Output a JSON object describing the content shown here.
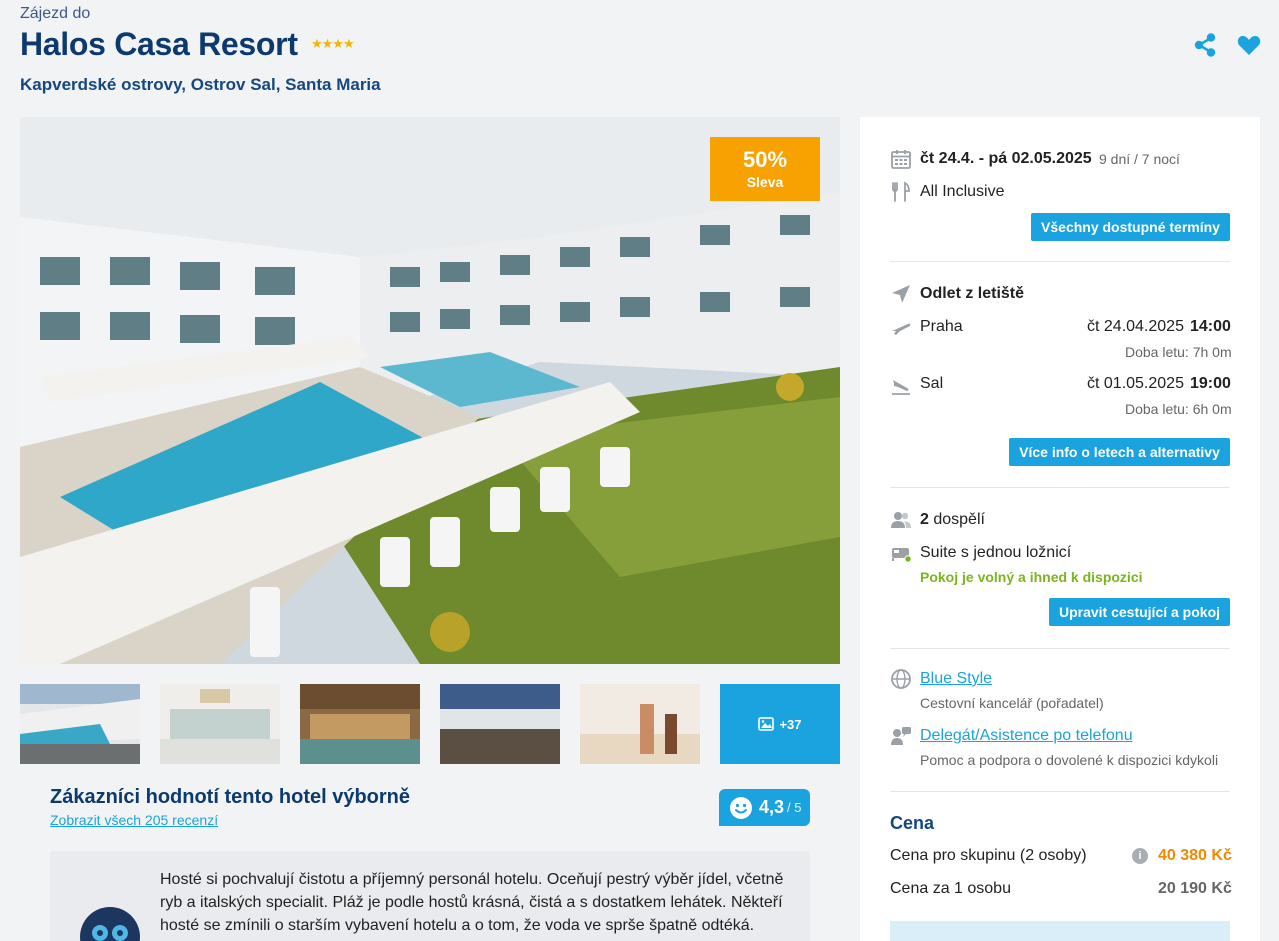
{
  "header": {
    "pre_title": "Zájezd do",
    "title": "Halos Casa Resort",
    "stars": "★★★★",
    "location": "Kapverdské ostrovy, Ostrov Sal, Santa Maria"
  },
  "gallery": {
    "discount_percent": "50%",
    "discount_label": "Sleva",
    "more_photos": "+37"
  },
  "reviews": {
    "heading": "Zákazníci hodnotí tento hotel výborně",
    "link": "Zobrazit všech 205 recenzí",
    "rating": "4,3",
    "rating_max": "/ 5",
    "summary": "Hosté si pochvalují čistotu a příjemný personál hotelu. Oceňují pestrý výběr jídel, včetně ryb a italských specialit. Pláž je podle hostů krásná, čistá a s dostatkem lehátek. Někteří hosté se zmínili o starším vybavení hotelu a o tom, že voda ve sprše špatně odtéká."
  },
  "trip": {
    "dates": "čt 24.4. - pá 02.05.2025",
    "duration": "9 dní / 7 nocí",
    "board": "All Inclusive",
    "all_dates_button": "Všechny dostupné termíny"
  },
  "flights": {
    "heading": "Odlet z letiště",
    "outbound_city": "Praha",
    "outbound_date": "čt 24.04.2025",
    "outbound_time": "14:00",
    "outbound_duration": "Doba letu: 7h 0m",
    "return_city": "Sal",
    "return_date": "čt 01.05.2025",
    "return_time": "19:00",
    "return_duration": "Doba letu: 6h 0m",
    "more_button": "Více info o letech a alternativy"
  },
  "room": {
    "adults_count": "2",
    "adults_label": "dospělí",
    "type": "Suite s jednou ložnicí",
    "availability": "Pokoj je volný a ihned k dispozici",
    "edit_button": "Upravit cestující a pokoj"
  },
  "provider": {
    "name": "Blue Style",
    "role": "Cestovní kancelář (pořadatel)",
    "delegate": "Delegát/Asistence po telefonu",
    "delegate_desc": "Pomoc a podpora o dovolené k dispozici kdykoli"
  },
  "price": {
    "heading": "Cena",
    "group_label": "Cena pro skupinu (2 osoby)",
    "group_value": "40 380 Kč",
    "person_label": "Cena za 1 osobu",
    "person_value": "20 190 Kč"
  },
  "colors": {
    "accent": "#1aa3df",
    "title": "#0d3a6e",
    "discount": "#f7a200",
    "available": "#7ab51d",
    "price": "#f08a00"
  }
}
